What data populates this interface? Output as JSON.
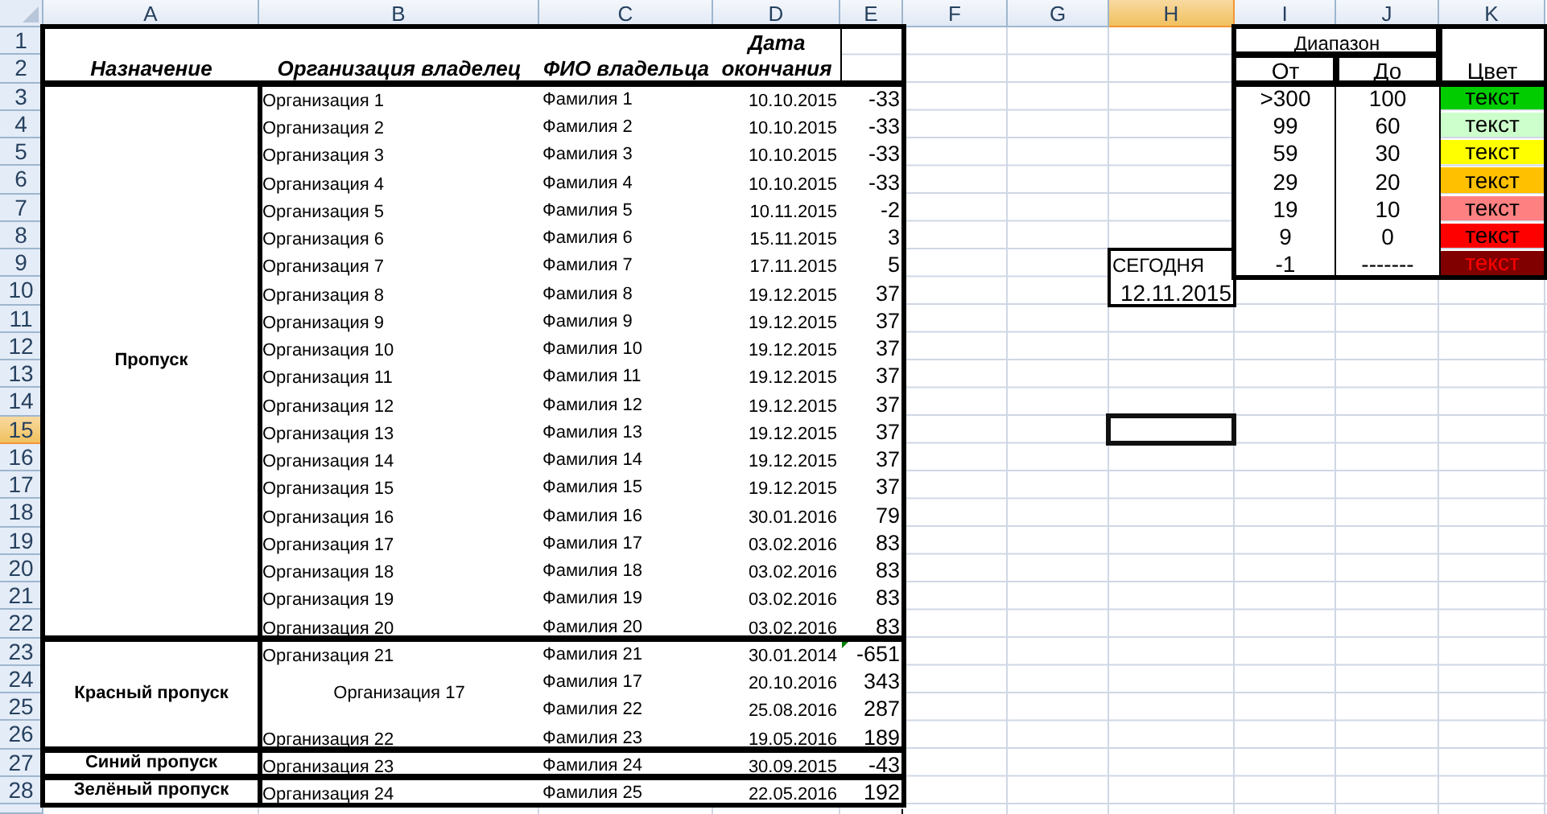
{
  "columns": [
    {
      "label": "A",
      "selected": false
    },
    {
      "label": "B",
      "selected": false
    },
    {
      "label": "C",
      "selected": false
    },
    {
      "label": "D",
      "selected": false
    },
    {
      "label": "E",
      "selected": false
    },
    {
      "label": "F",
      "selected": false
    },
    {
      "label": "G",
      "selected": false
    },
    {
      "label": "H",
      "selected": true
    },
    {
      "label": "I",
      "selected": false
    },
    {
      "label": "J",
      "selected": false
    },
    {
      "label": "K",
      "selected": false
    }
  ],
  "rows": [
    {
      "label": "1",
      "selected": false
    },
    {
      "label": "2",
      "selected": false
    },
    {
      "label": "3",
      "selected": false
    },
    {
      "label": "4",
      "selected": false
    },
    {
      "label": "5",
      "selected": false
    },
    {
      "label": "6",
      "selected": false
    },
    {
      "label": "7",
      "selected": false
    },
    {
      "label": "8",
      "selected": false
    },
    {
      "label": "9",
      "selected": false
    },
    {
      "label": "10",
      "selected": false
    },
    {
      "label": "11",
      "selected": false
    },
    {
      "label": "12",
      "selected": false
    },
    {
      "label": "13",
      "selected": false
    },
    {
      "label": "14",
      "selected": false
    },
    {
      "label": "15",
      "selected": true
    },
    {
      "label": "16",
      "selected": false
    },
    {
      "label": "17",
      "selected": false
    },
    {
      "label": "18",
      "selected": false
    },
    {
      "label": "19",
      "selected": false
    },
    {
      "label": "20",
      "selected": false
    },
    {
      "label": "21",
      "selected": false
    },
    {
      "label": "22",
      "selected": false
    },
    {
      "label": "23",
      "selected": false
    },
    {
      "label": "24",
      "selected": false
    },
    {
      "label": "25",
      "selected": false
    },
    {
      "label": "26",
      "selected": false
    },
    {
      "label": "27",
      "selected": false
    },
    {
      "label": "28",
      "selected": false
    }
  ],
  "table": {
    "headers": [
      "Назначение",
      "Организация владелец",
      "ФИО владельца",
      "Дата окончания"
    ],
    "groups": [
      {
        "purpose": "Пропуск",
        "orgs": [
          {
            "name": "Организация 1",
            "people": [
              {
                "name": "Фамилия 1",
                "date": "10.10.2015",
                "days": "-33",
                "flagged": false
              }
            ]
          },
          {
            "name": "Организация 2",
            "people": [
              {
                "name": "Фамилия 2",
                "date": "10.10.2015",
                "days": "-33",
                "flagged": false
              }
            ]
          },
          {
            "name": "Организация 3",
            "people": [
              {
                "name": "Фамилия 3",
                "date": "10.10.2015",
                "days": "-33",
                "flagged": false
              }
            ]
          },
          {
            "name": "Организация 4",
            "people": [
              {
                "name": "Фамилия 4",
                "date": "10.10.2015",
                "days": "-33",
                "flagged": false
              }
            ]
          },
          {
            "name": "Организация 5",
            "people": [
              {
                "name": "Фамилия 5",
                "date": "10.11.2015",
                "days": "-2",
                "flagged": false
              }
            ]
          },
          {
            "name": "Организация 6",
            "people": [
              {
                "name": "Фамилия 6",
                "date": "15.11.2015",
                "days": "3",
                "flagged": false
              }
            ]
          },
          {
            "name": "Организация 7",
            "people": [
              {
                "name": "Фамилия 7",
                "date": "17.11.2015",
                "days": "5",
                "flagged": false
              }
            ]
          },
          {
            "name": "Организация 8",
            "people": [
              {
                "name": "Фамилия 8",
                "date": "19.12.2015",
                "days": "37",
                "flagged": false
              }
            ]
          },
          {
            "name": "Организация 9",
            "people": [
              {
                "name": "Фамилия 9",
                "date": "19.12.2015",
                "days": "37",
                "flagged": false
              }
            ]
          },
          {
            "name": "Организация 10",
            "people": [
              {
                "name": "Фамилия 10",
                "date": "19.12.2015",
                "days": "37",
                "flagged": false
              }
            ]
          },
          {
            "name": "Организация 11",
            "people": [
              {
                "name": "Фамилия 11",
                "date": "19.12.2015",
                "days": "37",
                "flagged": false
              }
            ]
          },
          {
            "name": "Организация 12",
            "people": [
              {
                "name": "Фамилия 12",
                "date": "19.12.2015",
                "days": "37",
                "flagged": false
              }
            ]
          },
          {
            "name": "Организация 13",
            "people": [
              {
                "name": "Фамилия 13",
                "date": "19.12.2015",
                "days": "37",
                "flagged": false
              }
            ]
          },
          {
            "name": "Организация 14",
            "people": [
              {
                "name": "Фамилия 14",
                "date": "19.12.2015",
                "days": "37",
                "flagged": false
              }
            ]
          },
          {
            "name": "Организация 15",
            "people": [
              {
                "name": "Фамилия 15",
                "date": "19.12.2015",
                "days": "37",
                "flagged": false
              }
            ]
          },
          {
            "name": "Организация 16",
            "people": [
              {
                "name": "Фамилия 16",
                "date": "30.01.2016",
                "days": "79",
                "flagged": false
              }
            ]
          },
          {
            "name": "Организация 17",
            "people": [
              {
                "name": "Фамилия 17",
                "date": "03.02.2016",
                "days": "83",
                "flagged": false
              }
            ]
          },
          {
            "name": "Организация 18",
            "people": [
              {
                "name": "Фамилия 18",
                "date": "03.02.2016",
                "days": "83",
                "flagged": false
              }
            ]
          },
          {
            "name": "Организация 19",
            "people": [
              {
                "name": "Фамилия 19",
                "date": "03.02.2016",
                "days": "83",
                "flagged": false
              }
            ]
          },
          {
            "name": "Организация 20",
            "people": [
              {
                "name": "Фамилия 20",
                "date": "03.02.2016",
                "days": "83",
                "flagged": false
              }
            ]
          }
        ]
      },
      {
        "purpose": "Красный пропуск",
        "orgs": [
          {
            "name": "Организация 21",
            "people": [
              {
                "name": "Фамилия 21",
                "date": "30.01.2014",
                "days": "-651",
                "flagged": true
              }
            ]
          },
          {
            "name": "Организация 17",
            "people": [
              {
                "name": "Фамилия 17",
                "date": "20.10.2016",
                "days": "343",
                "flagged": false
              },
              {
                "name": "Фамилия 22",
                "date": "25.08.2016",
                "days": "287",
                "flagged": false
              }
            ]
          },
          {
            "name": "Организация 22",
            "people": [
              {
                "name": "Фамилия 23",
                "date": "19.05.2016",
                "days": "189",
                "flagged": false
              }
            ]
          }
        ]
      },
      {
        "purpose": "Синий пропуск",
        "orgs": [
          {
            "name": "Организация 23",
            "people": [
              {
                "name": "Фамилия 24",
                "date": "30.09.2015",
                "days": "-43",
                "flagged": false
              }
            ]
          }
        ]
      },
      {
        "purpose": "Зелёный пропуск",
        "orgs": [
          {
            "name": "Организация 24",
            "people": [
              {
                "name": "Фамилия 25",
                "date": "22.05.2016",
                "days": "192",
                "flagged": false
              }
            ]
          }
        ]
      }
    ]
  },
  "today": {
    "label": "СЕГОДНЯ",
    "date": "12.11.2015"
  },
  "legend": {
    "title": "Диапазон",
    "from_header": "От",
    "to_header": "До",
    "color_header": "Цвет",
    "ranges": [
      {
        "from": ">300",
        "to": "100",
        "label": "текст",
        "color": "#00cc00"
      },
      {
        "from": "99",
        "to": "60",
        "label": "текст",
        "color": "#ccffcc"
      },
      {
        "from": "59",
        "to": "30",
        "label": "текст",
        "color": "#ffff00"
      },
      {
        "from": "29",
        "to": "20",
        "label": "текст",
        "color": "#ffc000"
      },
      {
        "from": "19",
        "to": "10",
        "label": "текст",
        "color": "#ff8080"
      },
      {
        "from": "9",
        "to": "0",
        "label": "текст",
        "color": "#ff0000"
      },
      {
        "from": "-1",
        "to": "-------",
        "label": "текст",
        "color": "#800000"
      }
    ]
  }
}
